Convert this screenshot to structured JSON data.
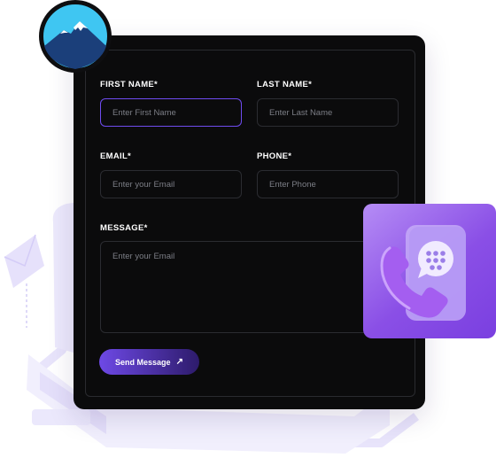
{
  "form": {
    "first_name": {
      "label": "FIRST NAME*",
      "placeholder": "Enter First Name"
    },
    "last_name": {
      "label": "LAST NAME*",
      "placeholder": "Enter Last Name"
    },
    "email": {
      "label": "EMAIL*",
      "placeholder": "Enter your Email"
    },
    "phone": {
      "label": "PHONE*",
      "placeholder": "Enter Phone"
    },
    "message": {
      "label": "MESSAGE*",
      "placeholder": "Enter your Email"
    },
    "submit_label": "Send Message",
    "submit_icon": "arrow-up-right-icon"
  },
  "colors": {
    "card_background": "#0b0b0c",
    "accent": "#6f4cf0",
    "button_gradient_start": "#6e49e6",
    "button_gradient_end": "#2d1b6b",
    "logo_ring": "#3fc6f2",
    "phone_tile": "#8a4fe6"
  },
  "decorations": {
    "logo_icon": "mountain-icon",
    "phone_icon": "phone-chat-icon",
    "envelope_icon": "envelope-icon"
  }
}
